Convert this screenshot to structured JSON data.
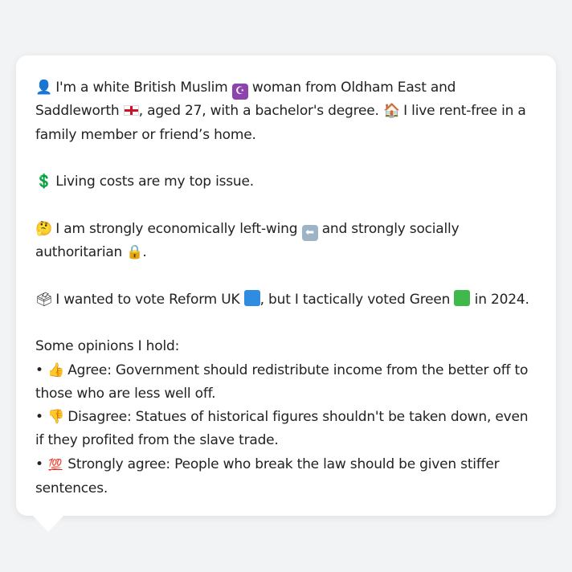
{
  "intro": {
    "person_icon": "👤",
    "text1": " I'm a white British Muslim ",
    "crescent_icon": "☪",
    "text2": " woman from Oldham East and Saddleworth ",
    "text3": ", aged 27, with a bachelor's degree. ",
    "house_icon": "🏠",
    "text4": " I live rent-free in a family member or friend’s home."
  },
  "issue": {
    "dollar_icon": "💲",
    "text": " Living costs are my top issue."
  },
  "politics": {
    "thinking_icon": "🤔",
    "text1": " I am strongly economically left-wing ",
    "left_arrow_icon": "⬅",
    "text2": " and strongly socially authoritarian ",
    "lock_icon": "🔒",
    "text3": "."
  },
  "vote": {
    "ballot_icon": "🗳",
    "text1": " I wanted to vote Reform UK ",
    "text2": ", but I tactically voted Green ",
    "text3": " in 2024.",
    "reform_color": "#2f8ce0",
    "green_color": "#3fb94a"
  },
  "opinions": {
    "heading": "Some opinions I hold:",
    "bullet": "• ",
    "items": [
      {
        "icon": "👍",
        "text": " Agree: Government should redistribute income from the better off to those who are less well off."
      },
      {
        "icon": "👎",
        "text": " Disagree: Statues of historical figures shouldn't be taken down, even if they profited from the slave trade."
      },
      {
        "icon": "💯",
        "text": " Strongly agree: People who break the law should be given stiffer sentences."
      }
    ]
  }
}
